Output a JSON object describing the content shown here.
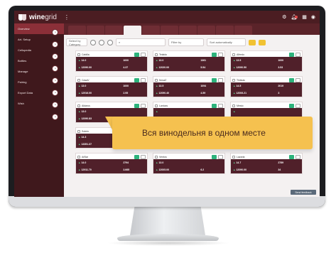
{
  "app": {
    "brand_primary": "wine",
    "brand_secondary": "grid",
    "menu_icon": "ellipsis-icon"
  },
  "topbar": {
    "icons": [
      "gear-icon",
      "bell-icon",
      "grid-icon",
      "user-icon"
    ]
  },
  "sidebar": {
    "items": [
      {
        "label": "Overview"
      },
      {
        "label": "Art. Setup"
      },
      {
        "label": "Cellopedia"
      },
      {
        "label": "Bottles"
      },
      {
        "label": "Manage"
      },
      {
        "label": "Pairing"
      },
      {
        "label": "Export Data"
      },
      {
        "label": "Wish"
      }
    ]
  },
  "tabs": [
    {
      "label": ""
    },
    {
      "label": ""
    },
    {
      "label": ""
    },
    {
      "label": ""
    },
    {
      "label": ""
    },
    {
      "label": ""
    },
    {
      "label": ""
    },
    {
      "label": ""
    },
    {
      "label": ""
    },
    {
      "label": ""
    }
  ],
  "toolbar": {
    "select_label": "Select by Category",
    "search_placeholder": "",
    "filter_label": "Filter by",
    "sort_label": "Sort automatically"
  },
  "cards": [
    {
      "title": "Cabilla",
      "v1": "14.0",
      "v2": "1000",
      "v3": "12090.00",
      "v4": "4.37"
    },
    {
      "title": "Telaldo",
      "v1": "13.0",
      "v2": "1361",
      "v3": "12020.00",
      "v4": "5.54"
    },
    {
      "title": "Alfredo",
      "v1": "13.5",
      "v2": "1000",
      "v3": "12090.50",
      "v4": "3.53"
    },
    {
      "title": "CasaV",
      "v1": "13.0",
      "v2": "1000",
      "v3": "12916.00",
      "v4": "2.95"
    },
    {
      "title": "NovaZ",
      "v1": "13.5",
      "v2": "1094",
      "v3": "12090.40",
      "v4": "4.59"
    },
    {
      "title": "Tinticas",
      "v1": "14.5",
      "v2": "2019",
      "v3": "12006.21",
      "v4": "3"
    },
    {
      "title": "Aldarus",
      "v1": "13.0",
      "v2": "",
      "v3": "12090.83",
      "v4": ""
    },
    {
      "title": "Lanicas",
      "v1": "",
      "v2": "",
      "v3": "",
      "v4": ""
    },
    {
      "title": "Mesto",
      "v1": "",
      "v2": "",
      "v3": "",
      "v4": ""
    },
    {
      "title": "Sobrin",
      "v1": "14.3",
      "v2": "2941",
      "v3": "13351.37",
      "v4": ""
    },
    {
      "title": "",
      "v1": "",
      "v2": "",
      "v3": "",
      "v4": ""
    },
    {
      "title": "",
      "v1": "",
      "v2": "",
      "v3": "",
      "v4": ""
    },
    {
      "title": "ArBar",
      "v1": "14.0",
      "v2": "2794",
      "v3": "12911.70",
      "v4": "3.665"
    },
    {
      "title": "Ventos",
      "v1": "13.0",
      "v2": "",
      "v3": "12005.00",
      "v4": "6.2"
    },
    {
      "title": "Lazaria",
      "v1": "14.7",
      "v2": "2789",
      "v3": "12090.00",
      "v4": "34"
    }
  ],
  "footer": {
    "button_label": "Send feedback"
  },
  "callout": {
    "text": "Вся винодельня в одном месте"
  },
  "colors": {
    "brand": "#4b1d22",
    "accent": "#8b2f38",
    "callout": "#f5c14f",
    "positive": "#2db37c"
  }
}
